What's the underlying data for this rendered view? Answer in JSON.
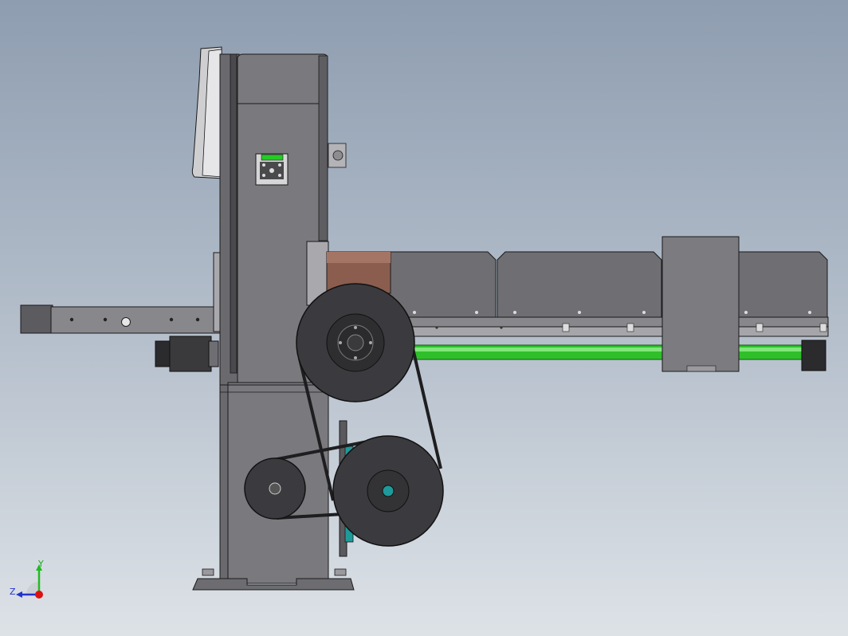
{
  "triad": {
    "x_label": "",
    "y_label": "Y",
    "z_label": "Z",
    "y_color": "#22bb22",
    "z_color": "#2233cc",
    "origin_color": "#dd1111"
  },
  "colors": {
    "body": "#78777d",
    "body_dark": "#55545a",
    "edge": "#1a1a1a",
    "pulley": "#3b3b3f",
    "shaft_green": "#2fbf2a",
    "motor_brown": "#8a5d4f",
    "hub_teal": "#1e9a9a",
    "label_green": "#22cc22"
  }
}
